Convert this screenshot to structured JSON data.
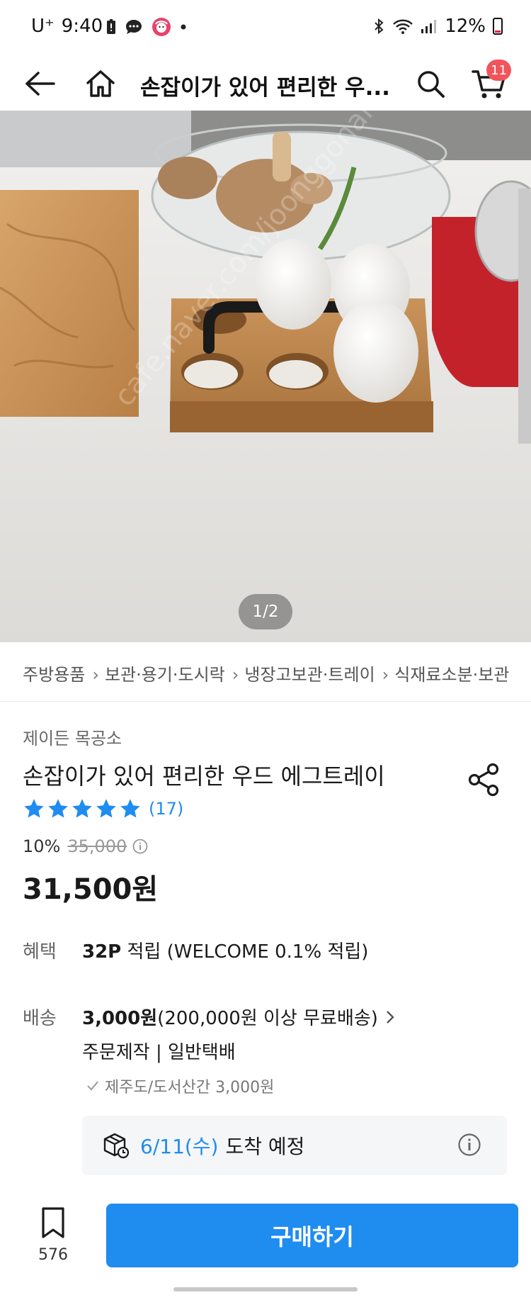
{
  "status_bar": {
    "carrier": "U⁺",
    "time": "9:40",
    "battery": "12%"
  },
  "header": {
    "title": "손잡이가 있어 편리한 우...",
    "cart_count": "11"
  },
  "gallery": {
    "pager": "1/2"
  },
  "breadcrumb": [
    "주방용품",
    "보관·용기·도시락",
    "냉장고보관·트레이",
    "식재료소분·보관"
  ],
  "product": {
    "seller": "제이든 목공소",
    "title": "손잡이가 있어 편리한 우드 에그트레이",
    "review_count": "(17)",
    "rating_stars": 5,
    "discount": "10%",
    "original_price": "35,000",
    "final_price": "31,500원"
  },
  "benefit": {
    "label": "혜택",
    "points": "32P",
    "text": " 적립 (WELCOME 0.1% 적립)"
  },
  "shipping": {
    "label": "배송",
    "fee": "3,000원",
    "free_condition": " (200,000원 이상 무료배송)",
    "method": "주문제작 | 일반택배",
    "jeju": "제주도/도서산간 3,000원"
  },
  "arrival": {
    "date": "6/11(수)",
    "text": "도착 예정"
  },
  "bottom": {
    "bookmark_count": "576",
    "buy_label": "구매하기"
  },
  "colors": {
    "accent": "#1f8cf0",
    "badge": "#f2545b"
  }
}
